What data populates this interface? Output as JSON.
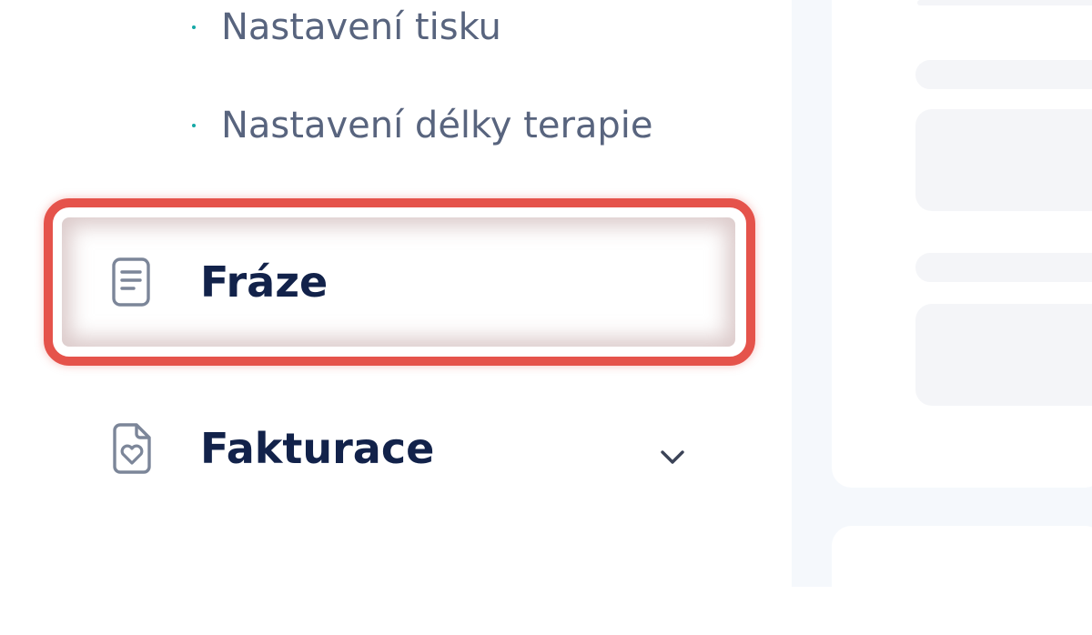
{
  "sidebar": {
    "sub_items": [
      {
        "label": "Nastavení tisku"
      },
      {
        "label": "Nastavení délky terapie"
      }
    ],
    "items": [
      {
        "label": "Fráze",
        "icon": "document-icon",
        "active": true
      },
      {
        "label": "Fakturace",
        "icon": "document-heart-icon",
        "expandable": true
      }
    ]
  },
  "colors": {
    "accent_dot": "#14a8a6",
    "highlight": "#e5534b",
    "text_primary": "#12224a",
    "text_secondary": "#58647e"
  }
}
